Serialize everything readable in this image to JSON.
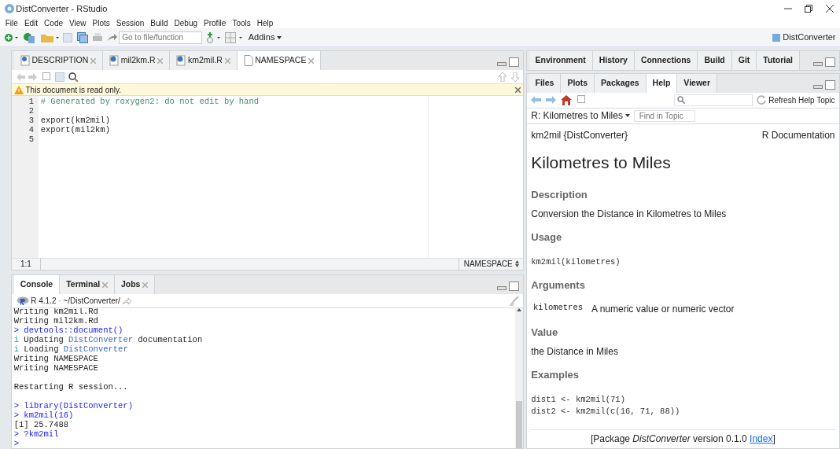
{
  "window": {
    "title": "DistConverter - RStudio"
  },
  "menu": [
    "File",
    "Edit",
    "Code",
    "View",
    "Plots",
    "Session",
    "Build",
    "Debug",
    "Profile",
    "Tools",
    "Help"
  ],
  "toolbar": {
    "goto_placeholder": "Go to file/function",
    "addins": "Addins",
    "project": "DistConverter"
  },
  "editor": {
    "tabs": [
      {
        "label": "DESCRIPTION",
        "kind": "gear",
        "selected": false
      },
      {
        "label": "mil2km.R",
        "kind": "r",
        "selected": false
      },
      {
        "label": "km2mil.R",
        "kind": "r",
        "selected": false
      },
      {
        "label": "NAMESPACE",
        "kind": "doc",
        "selected": true
      }
    ],
    "notice": "This document is read only.",
    "lines": [
      {
        "number": "1",
        "text": "# Generated by roxygen2: do not edit by hand",
        "kind": "comment"
      },
      {
        "number": "2"
      },
      {
        "number": "3",
        "text": "export(km2mil)",
        "kind": "code"
      },
      {
        "number": "4",
        "text": "export(mil2km)",
        "kind": "code"
      },
      {
        "number": "5"
      }
    ],
    "position": "1:1",
    "file_type": "NAMESPACE"
  },
  "console": {
    "tabs": [
      {
        "label": "Console",
        "selected": true,
        "closable": false
      },
      {
        "label": "Terminal",
        "selected": false,
        "closable": true
      },
      {
        "label": "Jobs",
        "selected": false,
        "closable": true
      }
    ],
    "version": "R 4.1.2",
    "separator": "·",
    "path": "~/DistConverter/",
    "lines": [
      {
        "kind": "text",
        "segments": [
          {
            "text": "Writing km2mil.Rd",
            "kind": "output"
          }
        ]
      },
      {
        "kind": "text",
        "segments": [
          {
            "text": "Writing mil2km.Rd",
            "kind": "output"
          }
        ]
      },
      {
        "kind": "text",
        "segments": [
          {
            "text": "> devtools::document()",
            "kind": "command"
          }
        ]
      },
      {
        "kind": "text",
        "segments": [
          {
            "text": "i",
            "kind": "info"
          },
          {
            "text": " Updating ",
            "kind": "output"
          },
          {
            "text": "DistConverter",
            "kind": "package"
          },
          {
            "text": " documentation",
            "kind": "output"
          }
        ]
      },
      {
        "kind": "text",
        "segments": [
          {
            "text": "i",
            "kind": "info"
          },
          {
            "text": " Loading ",
            "kind": "output"
          },
          {
            "text": "DistConverter",
            "kind": "package"
          }
        ]
      },
      {
        "kind": "text",
        "segments": [
          {
            "text": "Writing NAMESPACE",
            "kind": "output"
          }
        ]
      },
      {
        "kind": "text",
        "segments": [
          {
            "text": "Writing NAMESPACE",
            "kind": "output"
          }
        ]
      },
      {
        "kind": "blank"
      },
      {
        "kind": "text",
        "segments": [
          {
            "text": "Restarting R session...",
            "kind": "output"
          }
        ]
      },
      {
        "kind": "blank"
      },
      {
        "kind": "text",
        "segments": [
          {
            "text": "> library(DistConverter)",
            "kind": "command"
          }
        ]
      },
      {
        "kind": "text",
        "segments": [
          {
            "text": "> km2mil(16)",
            "kind": "command"
          }
        ]
      },
      {
        "kind": "text",
        "segments": [
          {
            "text": "[1] 25.7488",
            "kind": "output"
          }
        ]
      },
      {
        "kind": "text",
        "segments": [
          {
            "text": "> ?km2mil",
            "kind": "command"
          }
        ]
      },
      {
        "kind": "text",
        "segments": [
          {
            "text": ">",
            "kind": "command"
          }
        ]
      }
    ]
  },
  "env_tabs": [
    {
      "label": "Environment",
      "selected": false
    },
    {
      "label": "History",
      "selected": false
    },
    {
      "label": "Connections",
      "selected": false
    },
    {
      "label": "Build",
      "selected": false
    },
    {
      "label": "Git",
      "selected": false
    },
    {
      "label": "Tutorial",
      "selected": false
    }
  ],
  "help_tabs": [
    {
      "label": "Files",
      "selected": false
    },
    {
      "label": "Plots",
      "selected": false
    },
    {
      "label": "Packages",
      "selected": false
    },
    {
      "label": "Help",
      "selected": true
    },
    {
      "label": "Viewer",
      "selected": false
    }
  ],
  "help": {
    "refresh": "Refresh Help Topic",
    "topic": "R: Kilometres to Miles",
    "find_placeholder": "Find in Topic",
    "name": "km2mil {DistConverter}",
    "doc_label": "R Documentation",
    "title": "Kilometres to Miles",
    "blocks": [
      {
        "kind": "heading",
        "text": "Description"
      },
      {
        "kind": "para",
        "text": "Conversion the Distance in Kilometres to Miles"
      },
      {
        "kind": "heading",
        "text": "Usage"
      },
      {
        "kind": "code",
        "text": "km2mil(kilometres)"
      },
      {
        "kind": "heading",
        "text": "Arguments"
      },
      {
        "kind": "arg",
        "name": "kilometres",
        "text": "A numeric value or numeric vector"
      },
      {
        "kind": "heading",
        "text": "Value"
      },
      {
        "kind": "para",
        "text": "the Distance in Miles"
      },
      {
        "kind": "heading",
        "text": "Examples"
      },
      {
        "kind": "code",
        "text": "dist1 <- km2mil(71)\ndist2 <- km2mil(c(16, 71, 88))"
      }
    ],
    "footer": "[Package *DistConverter* version 0.1.0",
    "footer_link": "Index",
    "footer_end": "]"
  }
}
